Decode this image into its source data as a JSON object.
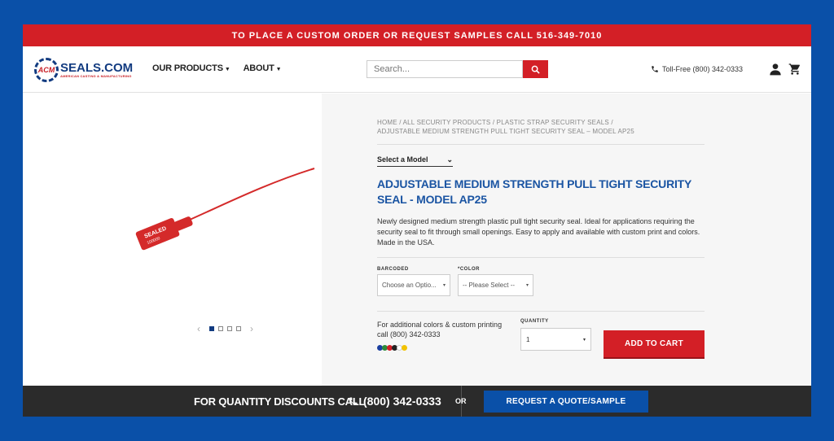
{
  "topbar": {
    "text": "TO PLACE A CUSTOM ORDER OR REQUEST SAMPLES CALL 516-349-7010"
  },
  "header": {
    "logo_mark": "ACM",
    "logo_main": "SEALS.COM",
    "logo_sub": "AMERICAN CASTING & MANUFACTURING",
    "nav": [
      {
        "label": "OUR PRODUCTS"
      },
      {
        "label": "ABOUT"
      }
    ],
    "search_placeholder": "Search...",
    "tollfree": "Toll-Free (800) 342-0333"
  },
  "product": {
    "tag_text": "SEALED",
    "tag_code": "100000",
    "breadcrumb_line1": "HOME / ALL SECURITY PRODUCTS / PLASTIC STRAP SECURITY SEALS /",
    "breadcrumb_line2": "ADJUSTABLE MEDIUM STRENGTH PULL TIGHT SECURITY SEAL – MODEL AP25",
    "select_model": "Select a Model",
    "title": "ADJUSTABLE MEDIUM STRENGTH PULL TIGHT SECURITY SEAL - MODEL AP25",
    "description": "Newly designed medium strength plastic pull tight security seal. Ideal for applications requiring the security seal to fit through small openings. Easy to apply and available with custom print and colors. Made in the USA.",
    "options": {
      "barcoded_label": "BARCODED",
      "barcoded_value": "Choose an Optio...",
      "color_label": "*COLOR",
      "color_value": "-- Please Select --"
    },
    "additional_info": "For additional colors & custom printing call (800) 342-0333",
    "swatches": [
      "#1b3fa0",
      "#2e8b3a",
      "#d31f26",
      "#222222",
      "#ffffff",
      "#f2c200"
    ],
    "quantity_label": "QUANTITY",
    "quantity_value": "1",
    "add_to_cart": "ADD TO CART"
  },
  "bottombar": {
    "text": "FOR QUANTITY DISCOUNTS CALL",
    "phone": "(800) 342-0333",
    "or": "OR",
    "button": "REQUEST A QUOTE/SAMPLE"
  },
  "colors": {
    "brand_red": "#d31f26",
    "brand_blue": "#0a50a8",
    "title_blue": "#1b55a3"
  }
}
